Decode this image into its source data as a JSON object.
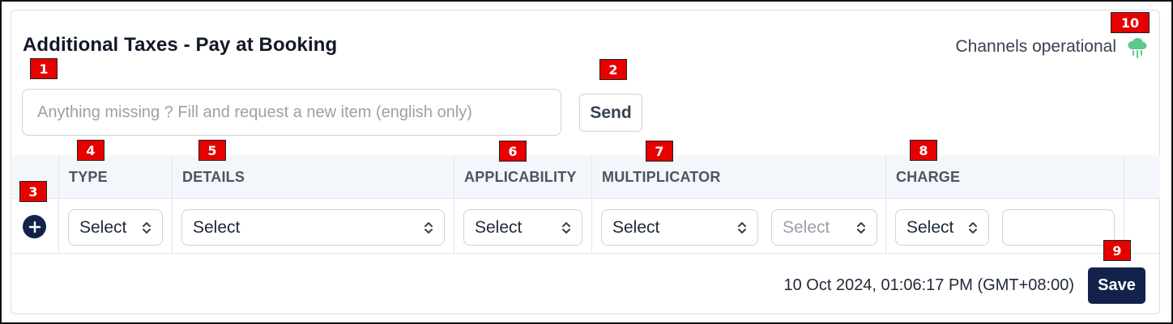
{
  "section": {
    "title": "Additional Taxes - Pay at Booking",
    "status_text": "Channels operational",
    "status_icon": "cloud-rain-icon",
    "status_color": "#5cc98a"
  },
  "request": {
    "placeholder": "Anything missing ? Fill and request a new item (english only)",
    "send_label": "Send"
  },
  "table": {
    "columns": [
      "TYPE",
      "DETAILS",
      "APPLICABILITY",
      "MULTIPLICATOR",
      "CHARGE"
    ],
    "row": {
      "type": "Select",
      "details": "Select",
      "applicability": "Select",
      "multiplicator_unit": "Select",
      "multiplicator_value": "Select",
      "charge_type": "Select",
      "charge_amount": ""
    }
  },
  "footer": {
    "timestamp": "10 Oct 2024, 01:06:17 PM (GMT+08:00)",
    "save_label": "Save"
  },
  "annotations": [
    "1",
    "2",
    "3",
    "4",
    "5",
    "6",
    "7",
    "8",
    "9",
    "10"
  ],
  "colors": {
    "primary": "#13224a",
    "badge": "#e60000",
    "header_bg": "#f3f6fa"
  }
}
